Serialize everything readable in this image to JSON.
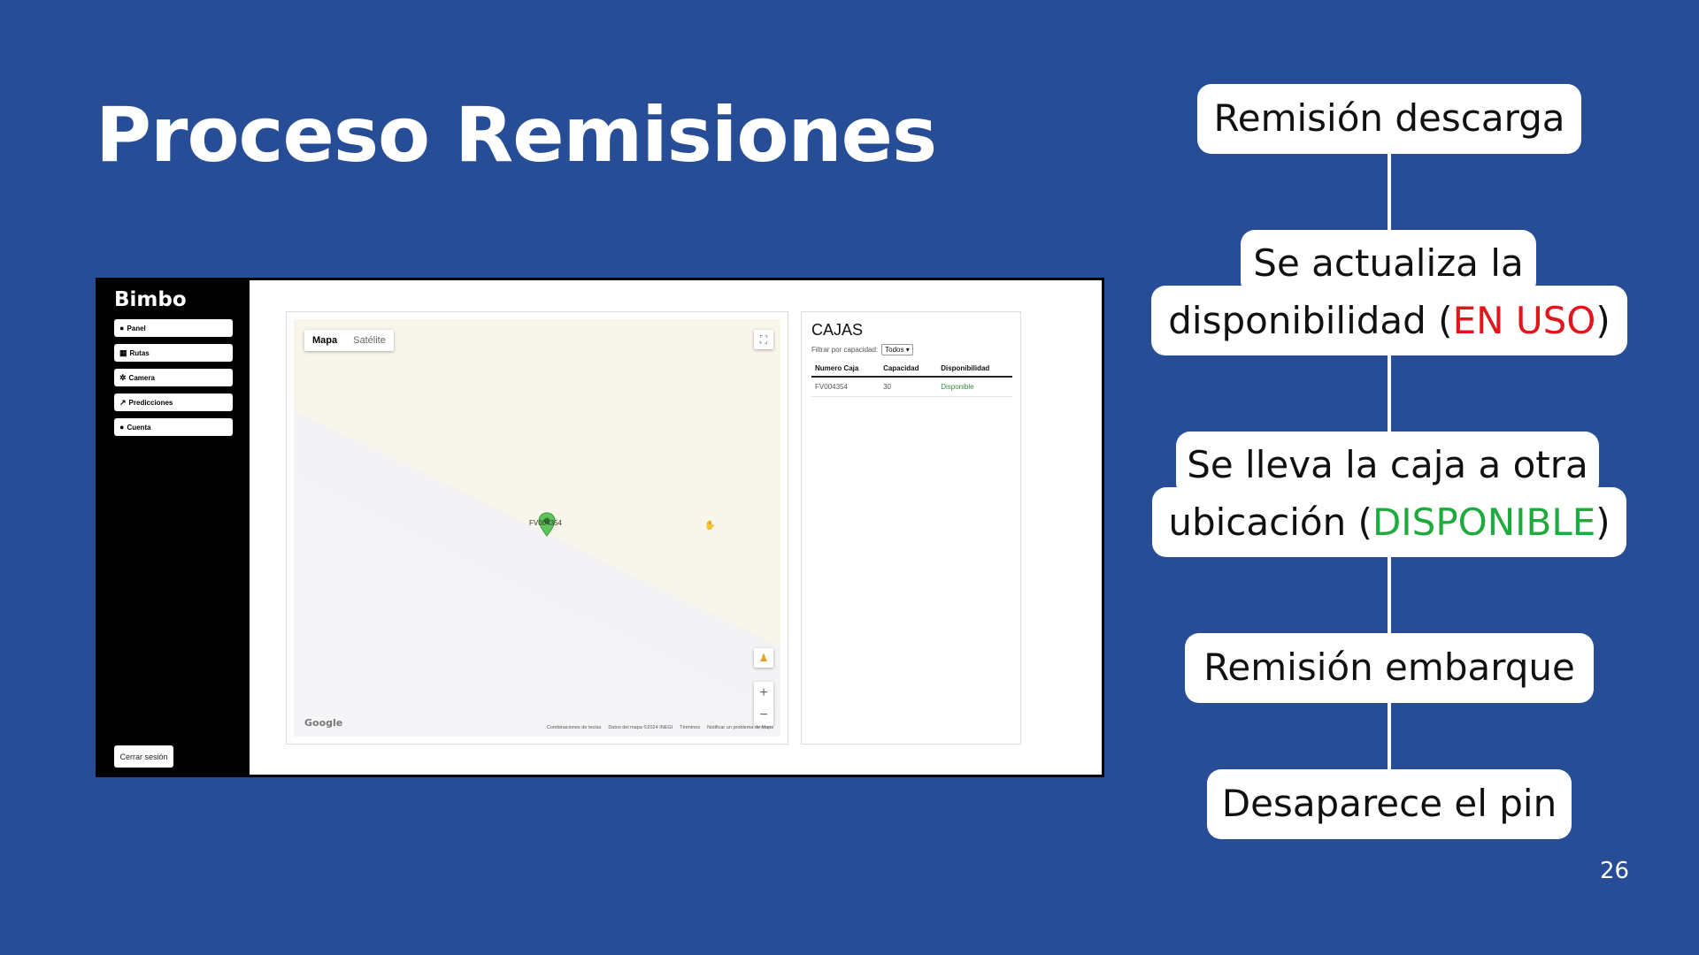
{
  "slide": {
    "title": "Proceso Remisiones",
    "page_number": "26"
  },
  "app": {
    "brand": "Bimbo",
    "nav": [
      {
        "label": "Panel",
        "icon": "info-circle-icon"
      },
      {
        "label": "Rutas",
        "icon": "map-icon"
      },
      {
        "label": "Camera",
        "icon": "gear-icon"
      },
      {
        "label": "Predicciones",
        "icon": "chart-line-icon"
      },
      {
        "label": "Cuenta",
        "icon": "user-icon"
      }
    ],
    "logout_label": "Cerrar sesión",
    "map": {
      "type_tabs": [
        "Mapa",
        "Satélite"
      ],
      "active_tab": "Mapa",
      "pin_label": "FV004354",
      "logo": "Google",
      "footer_links": [
        "Combinaciones de teclas",
        "Datos del mapa ©2024 INEGI",
        "Términos",
        "Notificar un problema de Maps"
      ]
    },
    "cajas": {
      "title": "CAJAS",
      "filter_label": "Filtrar por capacidad:",
      "filter_value": "Todos",
      "columns": [
        "Numero Caja",
        "Capacidad",
        "Disponibilidad"
      ],
      "rows": [
        [
          "FV004354",
          "30",
          "Disponible"
        ]
      ]
    }
  },
  "flow": {
    "step1": "Remisión descarga",
    "step2_line1": "Se actualiza la",
    "step2_line2_prefix": "disponibilidad (",
    "step2_line2_highlight": "EN USO",
    "step2_line2_suffix": ")",
    "step3_line1": "Se lleva la caja a otra",
    "step3_line2_prefix": "ubicación (",
    "step3_line2_highlight": "DISPONIBLE",
    "step3_line2_suffix": ")",
    "step4": "Remisión embarque",
    "step5": "Desaparece el pin"
  },
  "colors": {
    "background": "#264d96",
    "en_uso": "#e0161c",
    "disponible": "#1faa3d"
  }
}
